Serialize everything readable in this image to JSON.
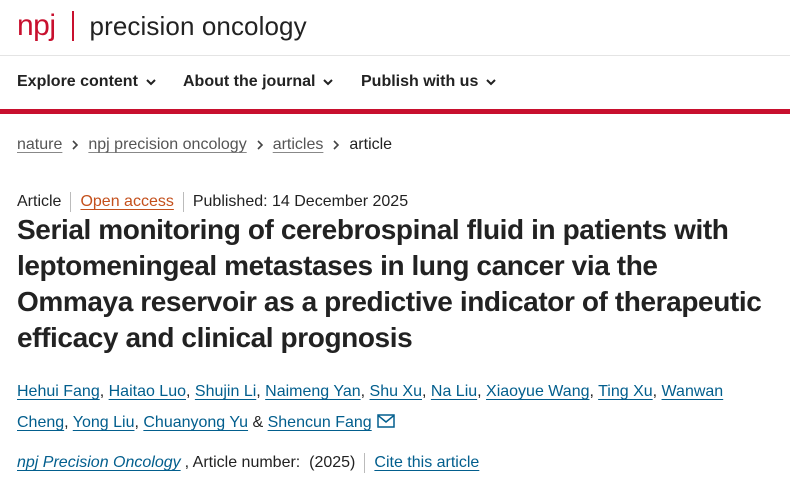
{
  "header": {
    "logo_npj": "npj",
    "logo_title": "precision oncology"
  },
  "nav": {
    "items": [
      "Explore content",
      "About the journal",
      "Publish with us"
    ]
  },
  "breadcrumb": {
    "items": [
      "nature",
      "npj precision oncology",
      "articles"
    ],
    "current": "article"
  },
  "meta": {
    "type": "Article",
    "open_access": "Open access",
    "published": "Published: 14 December 2025"
  },
  "article": {
    "title": "Serial monitoring of cerebrospinal fluid in patients with leptomeningeal metastases in lung cancer via the Ommaya reservoir as a predictive indicator of therapeutic efficacy and clinical prognosis",
    "authors": [
      "Hehui Fang",
      "Haitao Luo",
      "Shujin Li",
      "Naimeng Yan",
      "Shu Xu",
      "Na Liu",
      "Xiaoyue Wang",
      "Ting Xu",
      "Wanwan Cheng",
      "Yong Liu",
      "Chuanyong Yu",
      "Shencun Fang"
    ],
    "author_separator": ", ",
    "author_last_joiner": " & "
  },
  "citation": {
    "journal": "npj Precision Oncology",
    "article_number": ", Article number:  (2025)",
    "cite_link": "Cite this article"
  },
  "colors": {
    "brand": "#c8102e",
    "link": "#025e8d",
    "open_access": "#c4501c"
  }
}
